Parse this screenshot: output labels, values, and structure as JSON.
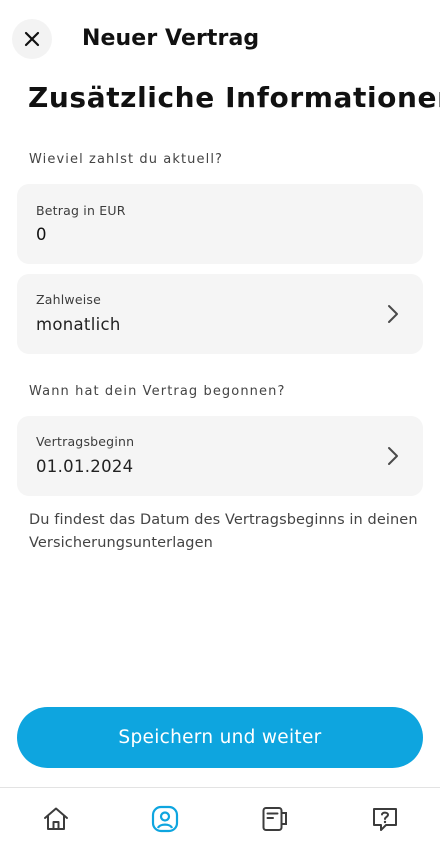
{
  "header": {
    "title": "Neuer Vertrag"
  },
  "page": {
    "title": "Zusätzliche Informationen"
  },
  "amount_section": {
    "label": "Wieviel zahlst du aktuell?",
    "amount_field": {
      "label": "Betrag in EUR",
      "value": "0"
    },
    "payment_field": {
      "label": "Zahlweise",
      "value": "monatlich"
    }
  },
  "start_section": {
    "label": "Wann hat dein Vertrag begonnen?",
    "start_field": {
      "label": "Vertragsbeginn",
      "value": "01.01.2024"
    },
    "hint": "Du findest das Datum des Vertragsbeginns in deinen Versicherungsunterlagen"
  },
  "actions": {
    "save_label": "Speichern und weiter"
  },
  "tabbar": {
    "items": [
      {
        "icon": "home-icon",
        "active": false
      },
      {
        "icon": "profile-icon",
        "active": true
      },
      {
        "icon": "contracts-icon",
        "active": false
      },
      {
        "icon": "help-icon",
        "active": false
      }
    ]
  },
  "colors": {
    "accent": "#0ea5df",
    "field_background": "#f5f5f5",
    "icon_inactive": "#3c3c3c"
  }
}
